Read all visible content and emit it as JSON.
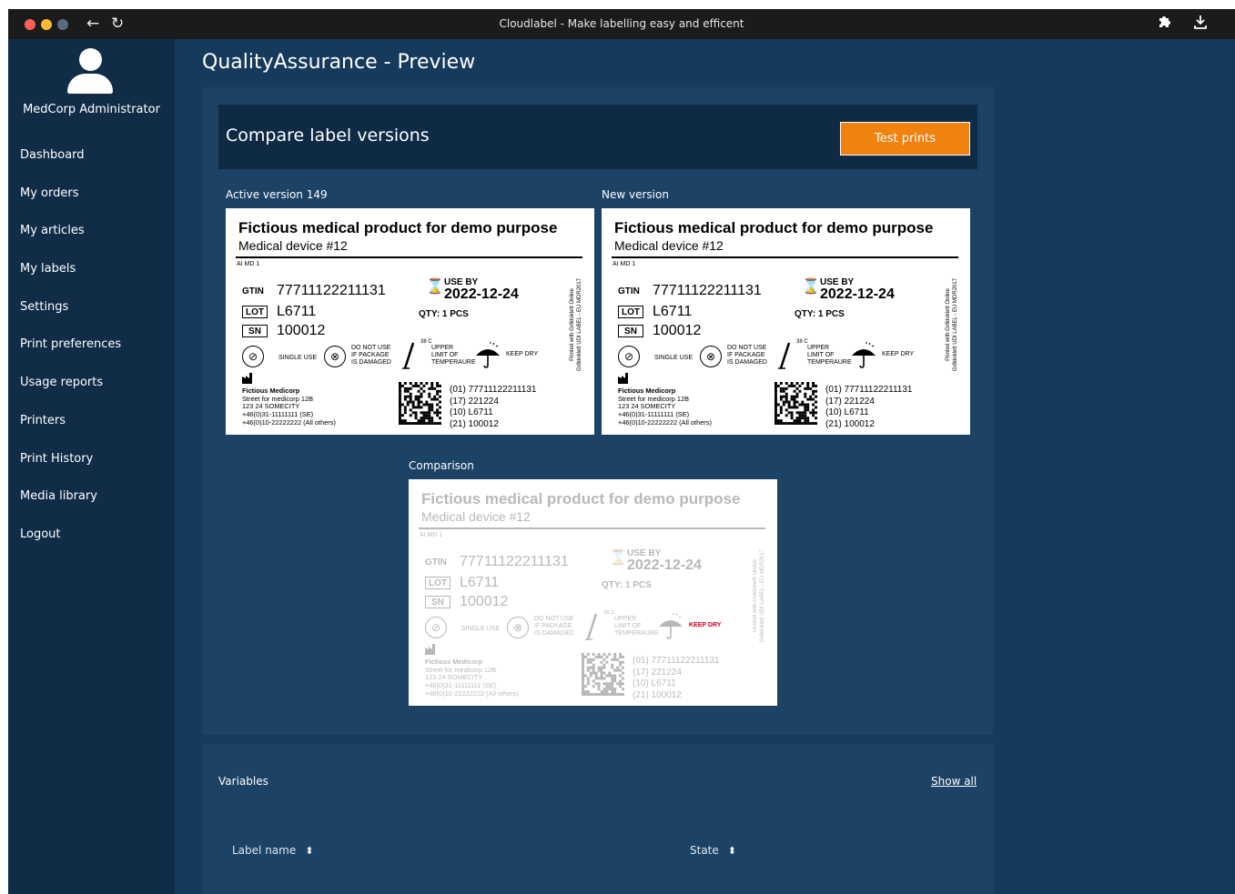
{
  "window": {
    "title": "Cloudlabel - Make labelling easy and efficent"
  },
  "titlebar": {
    "back": "←",
    "reload": "↻",
    "extensions_icon": "puzzle-icon",
    "download_icon": "download-icon"
  },
  "sidebar": {
    "user": "MedCorp Administrator",
    "items": [
      "Dashboard",
      "My orders",
      "My articles",
      "My labels",
      "Settings",
      "Print preferences",
      "Usage reports",
      "Printers",
      "Print History",
      "Media library",
      "Logout"
    ]
  },
  "page": {
    "title": "QualityAssurance - Preview"
  },
  "compare": {
    "title": "Compare label versions",
    "test_prints": "Test prints"
  },
  "labels": {
    "active": "Active version 149",
    "new": "New version",
    "comparison": "Comparison"
  },
  "label": {
    "title": "Fictious medical product for demo purpose",
    "subtitle": "Medical device #12",
    "aimd": "AI MD 1",
    "gtin_tag": "GTIN",
    "gtin": "77711122211131",
    "lot_tag": "LOT",
    "lot": "L6711",
    "sn_tag": "SN",
    "sn": "100012",
    "useby_label": "USE BY",
    "useby_date": "2022-12-24",
    "qty": "QTY: 1 PCS",
    "single_use": "SINGLE USE",
    "do_not_use": [
      "DO NOT USE",
      "IF PACKAGE",
      "IS DAMAGED"
    ],
    "temp_value": "38 C",
    "temp": [
      "UPPER",
      "LIMIT OF",
      "TEMPERAURE"
    ],
    "keep_dry": "KEEP DRY",
    "mfr_name": "Fictious Medicorp",
    "mfr_lines": [
      "Street for medicorp 12B",
      "123 24 SOMECITY",
      "+46(0)31-11111111 (SE)",
      "+46(0)10-22222222 (All others)"
    ],
    "ai_lines": [
      "(01) 77711122211131",
      "(17) 221224",
      "(10) L6711",
      "(21) 100012"
    ],
    "vertical": [
      "Printed with Gr8doklett Online",
      "Gr8doklett UDI LABEL - EU MDR2017"
    ]
  },
  "variables": {
    "title": "Variables",
    "show_all": "Show all",
    "col_label_name": "Label name",
    "col_state": "State"
  },
  "colors": {
    "accent": "#f0820f",
    "sidebar": "#112c47",
    "main": "#163a5c",
    "panel": "#1c4266",
    "diff": "#d0001a"
  }
}
